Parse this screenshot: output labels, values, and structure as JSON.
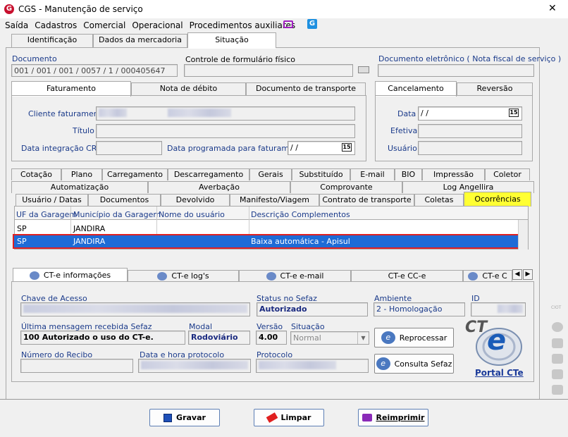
{
  "window": {
    "title": "CGS - Manutenção de serviço",
    "close": "✕"
  },
  "menu": [
    "Saída",
    "Cadastros",
    "Comercial",
    "Operacional",
    "Procedimentos auxiliares"
  ],
  "top_tabs": [
    "Identificação",
    "Dados da mercadoria",
    "Situação"
  ],
  "doc": {
    "label": "Documento",
    "value": "001 / 001 / 001 / 0057 / 1 / 000405647",
    "controle_label": "Controle de formulário físico",
    "eletronico_label": "Documento eletrônico ( Nota fiscal de serviço )"
  },
  "fat_tabs": [
    "Faturamento",
    "Nota de débito",
    "Documento de transporte"
  ],
  "fat": {
    "cliente_label": "Cliente faturamento",
    "titulo_label": "Título",
    "data_crc_label": "Data integração CRC",
    "data_prog_label": "Data programada para faturamento",
    "date_value": "/  /",
    "cal": "15"
  },
  "canc_tabs": [
    "Cancelamento",
    "Reversão"
  ],
  "canc": {
    "data_label": "Data",
    "data_value": "/  /",
    "cal": "15",
    "efetiva_label": "Efetiva",
    "usuario_label": "Usuário"
  },
  "mid_tabs_row1": [
    "Cotação",
    "Plano",
    "Carregamento",
    "Descarregamento",
    "Gerais",
    "Substituído",
    "E-mail",
    "BIO",
    "Impressão",
    "Coletor"
  ],
  "mid_tabs_row2": [
    "Automatização",
    "Averbação",
    "Comprovante",
    "Log Angellira"
  ],
  "mid_tabs_row3": [
    "Usuário / Datas",
    "Documentos",
    "Devolvido",
    "Manifesto/Viagem",
    "Contrato de transporte",
    "Coletas",
    "Ocorrências"
  ],
  "grid": {
    "headers": [
      "UF da Garagem",
      "Município da Garagem",
      "Nome do usuário",
      "Descrição Complementos"
    ],
    "rows": [
      [
        "SP",
        "JANDIRA",
        "",
        ""
      ],
      [
        "SP",
        "JANDIRA",
        "",
        "Baixa automática - Apisul"
      ]
    ]
  },
  "cte_tabs": [
    "CT-e informações",
    "CT-e log's",
    "CT-e e-mail",
    "CT-e CC-e",
    "CT-e C"
  ],
  "cte": {
    "chave_label": "Chave de Acesso",
    "status_label": "Status no Sefaz",
    "status_value": "Autorizado",
    "ambiente_label": "Ambiente",
    "ambiente_value": "2 - Homologação",
    "id_label": "ID",
    "ultima_label": "Última mensagem recebida Sefaz",
    "ultima_value": "100 Autorizado o uso do CT-e.",
    "modal_label": "Modal",
    "modal_value": "Rodoviário",
    "versao_label": "Versão",
    "versao_value": "4.00",
    "situacao_label": "Situação",
    "situacao_value": "Normal",
    "recibo_label": "Número do Recibo",
    "datahora_label": "Data e hora protocolo",
    "protocolo_label": "Protocolo",
    "reprocessar": "Reprocessar",
    "consulta": "Consulta Sefaz",
    "logo_text": "CT",
    "logo_e": "e",
    "portal": "Portal CTe"
  },
  "buttons": {
    "gravar": "Gravar",
    "limpar": "Limpar",
    "reimprimir": "Reimprimir"
  },
  "side": {
    "ciot": "CIOT"
  },
  "colors": {
    "accent": "#1e6bd6",
    "highlight_tab": "#ffff33",
    "row_select": "#1e6bd6",
    "row_border": "#e02020",
    "brand": "#c8102e"
  }
}
